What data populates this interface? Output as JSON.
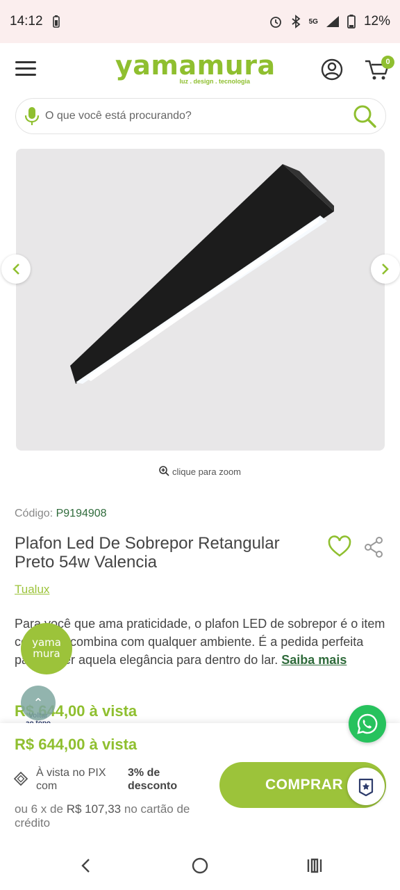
{
  "status_bar": {
    "time": "14:12",
    "network": "5G",
    "battery": "12%"
  },
  "header": {
    "logo_text": "yamamura",
    "logo_tagline": "luz . design . tecnologia",
    "cart_count": "0"
  },
  "search": {
    "placeholder": "O que você está procurando?"
  },
  "gallery": {
    "zoom_hint": "clique para zoom"
  },
  "product": {
    "code_label": "Código:",
    "code_value": "P9194908",
    "title": "Plafon Led De Sobrepor Retangular Preto 54w Valencia",
    "brand": "Tualux",
    "description": "Para você que ama praticidade, o plafon LED de sobrepor é o item certo que combina com qualquer ambiente. É a pedida perfeita para trazer aquela elegância para dentro do lar.",
    "read_more": "Saiba mais",
    "price_cash": "R$ 644,00 à vista"
  },
  "floating": {
    "logo_line1": "yama",
    "logo_line2": "mura",
    "back_to_top_line1": "Voltar",
    "back_to_top_line2": "ao topo"
  },
  "buy_bar": {
    "price": "R$ 644,00 à vista",
    "pix_text": "À vista no PIX com",
    "pix_discount": "3% de desconto",
    "buy_label": "COMPRAR",
    "installments_prefix": "ou 6 x de",
    "installments_amount": "R$ 107,33",
    "installments_suffix": "no cartão de crédito"
  },
  "colors": {
    "accent": "#8fbf2f",
    "dark_green": "#2f6b3b",
    "whatsapp": "#27c25d"
  },
  "icons": [
    "menu-icon",
    "user-icon",
    "cart-icon",
    "mic-icon",
    "search-icon",
    "chevron-left-icon",
    "chevron-right-icon",
    "zoom-icon",
    "heart-icon",
    "share-icon",
    "whatsapp-icon",
    "pix-icon",
    "badge-star-icon"
  ]
}
